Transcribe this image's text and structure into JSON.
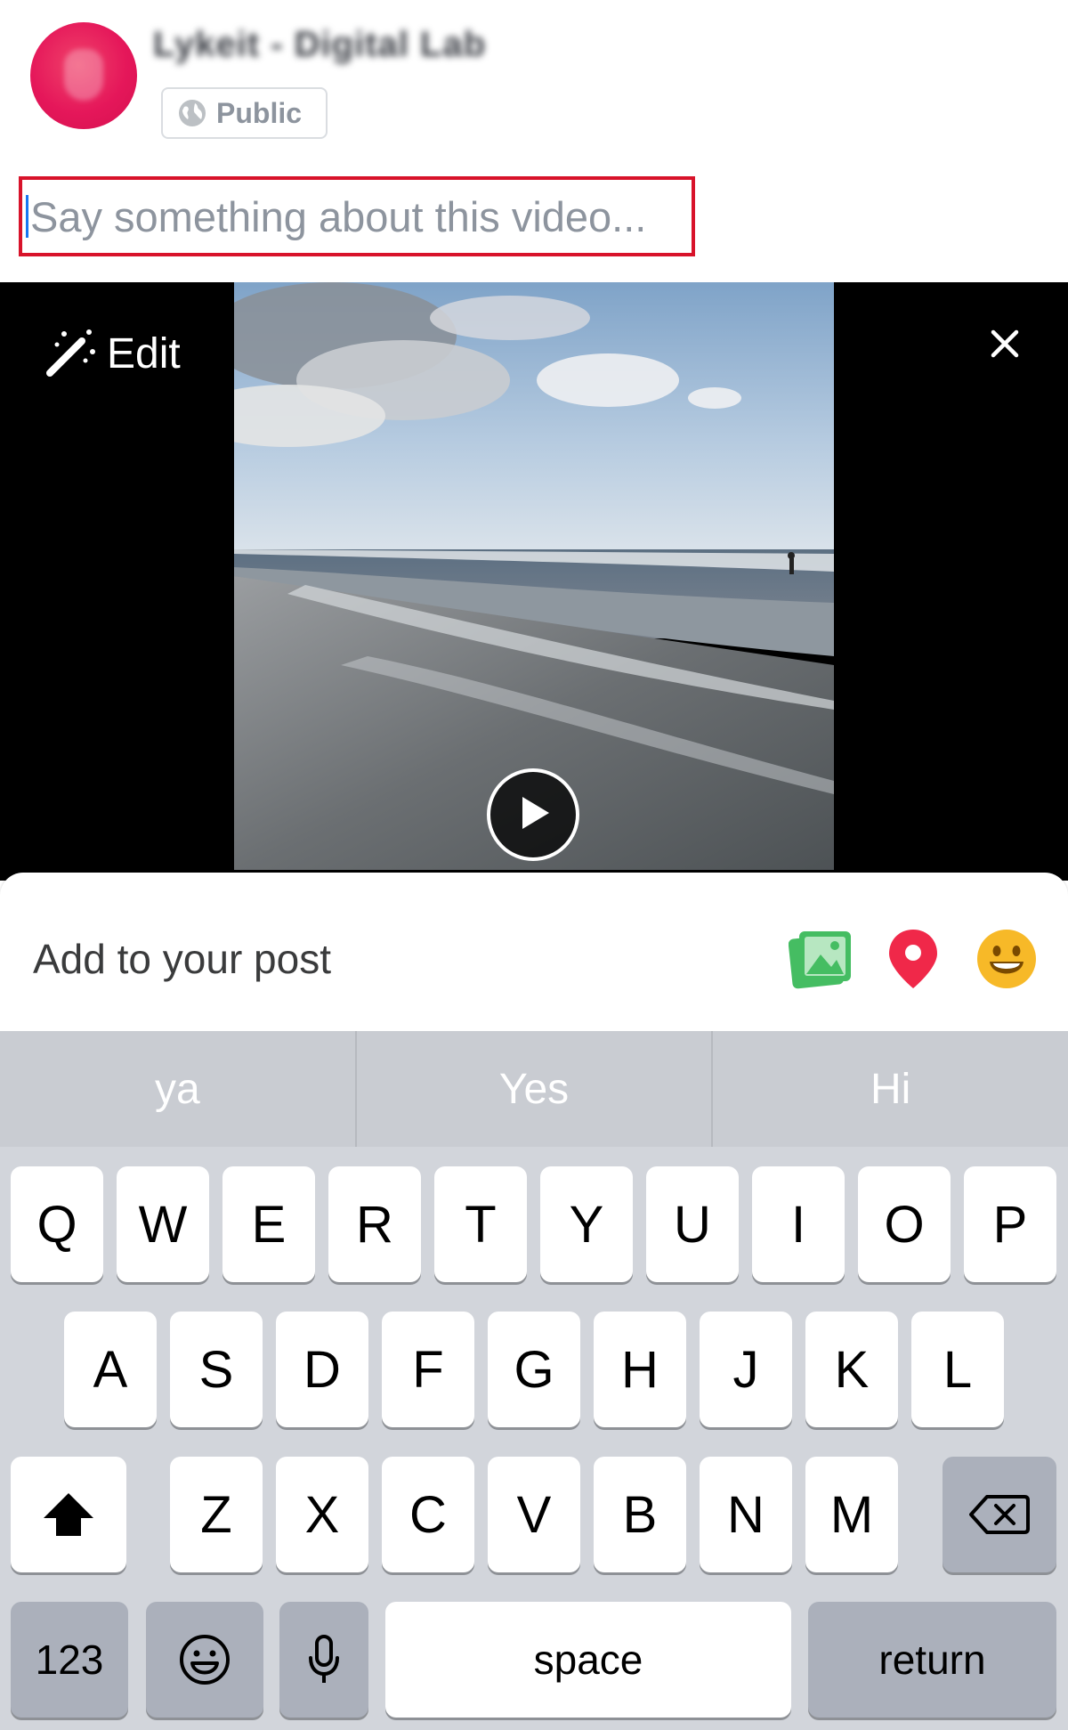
{
  "header": {
    "username": "Lykeit - Digital Lab",
    "privacy_label": "Public"
  },
  "composer": {
    "placeholder": "Say something about this video..."
  },
  "video": {
    "edit_label": "Edit",
    "close_icon": "close-icon",
    "play_icon": "play-icon"
  },
  "add_to_post": {
    "label": "Add to your post",
    "icons": [
      "photo-icon",
      "location-pin-icon",
      "emoji-icon"
    ],
    "colors": {
      "photo": "#45bd62",
      "location": "#f02849",
      "emoji": "#f7b928"
    }
  },
  "keyboard": {
    "suggestions": [
      "ya",
      "Yes",
      "Hi"
    ],
    "row1": [
      "Q",
      "W",
      "E",
      "R",
      "T",
      "Y",
      "U",
      "I",
      "O",
      "P"
    ],
    "row2": [
      "A",
      "S",
      "D",
      "F",
      "G",
      "H",
      "J",
      "K",
      "L"
    ],
    "row3": [
      "Z",
      "X",
      "C",
      "V",
      "B",
      "N",
      "M"
    ],
    "numbers_label": "123",
    "space_label": "space",
    "return_label": "return"
  }
}
